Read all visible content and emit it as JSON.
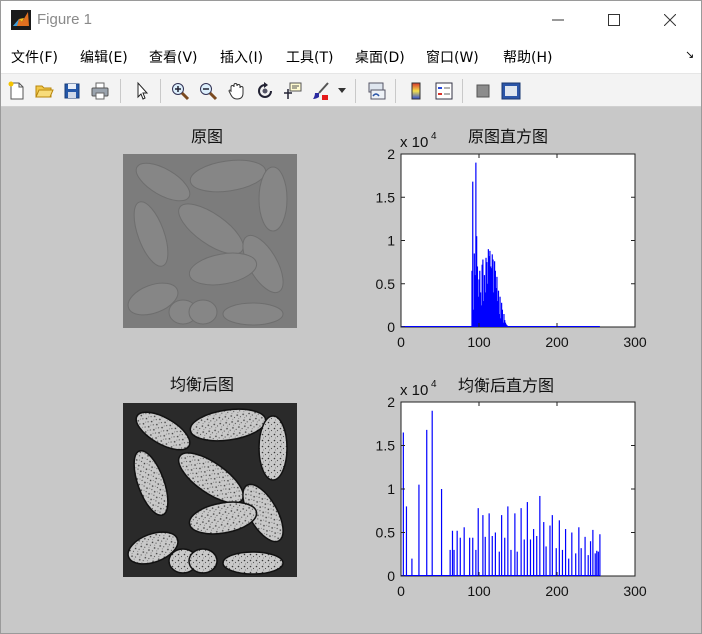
{
  "window": {
    "title": "Figure 1",
    "icon": "matlab-figure-icon",
    "controls": [
      "minimize-icon",
      "maximize-icon",
      "close-icon"
    ]
  },
  "menu": {
    "items": [
      "文件(F)",
      "编辑(E)",
      "查看(V)",
      "插入(I)",
      "工具(T)",
      "桌面(D)",
      "窗口(W)",
      "帮助(H)"
    ],
    "overflow_glyph": "↘"
  },
  "toolbar": {
    "icons": [
      "new-figure-icon",
      "open-file-icon",
      "save-icon",
      "print-icon",
      "edit-plot-arrow-icon",
      "zoom-in-icon",
      "zoom-out-icon",
      "pan-hand-icon",
      "rotate-3d-icon",
      "data-cursor-icon",
      "brush-icon",
      "brush-dropdown-icon",
      "link-plot-icon",
      "insert-colorbar-icon",
      "insert-legend-icon",
      "hide-plot-tools-icon",
      "show-plot-tools-icon"
    ]
  },
  "panels": {
    "original_image_title": "原图",
    "equalized_image_title": "均衡后图"
  },
  "chart_data": [
    {
      "type": "bar",
      "title": "原图直方图",
      "xlabel": "",
      "ylabel": "",
      "xlim": [
        0,
        300
      ],
      "ylim": [
        0,
        20000
      ],
      "xticks": [
        0,
        100,
        200,
        300
      ],
      "yticks": [
        0,
        0.5,
        1,
        1.5,
        2
      ],
      "ytick_labels": [
        "0",
        "0.5",
        "1",
        "1.5",
        "2"
      ],
      "y_exponent_label": "x 10",
      "y_exponent_power": "4",
      "color": "#0000ff",
      "grid": false,
      "x": [
        91,
        92,
        93,
        94,
        95,
        96,
        97,
        98,
        99,
        100,
        101,
        102,
        103,
        104,
        105,
        106,
        107,
        108,
        109,
        110,
        111,
        112,
        113,
        114,
        115,
        116,
        117,
        118,
        119,
        120,
        121,
        122,
        123,
        124,
        125,
        126,
        127,
        128,
        129,
        130,
        131,
        132,
        133,
        134,
        135,
        136,
        137,
        138
      ],
      "values": [
        6500,
        16800,
        2000,
        8500,
        6000,
        19000,
        10500,
        7000,
        3500,
        5500,
        6500,
        4000,
        2500,
        7200,
        7800,
        3000,
        6000,
        4000,
        8000,
        7500,
        5000,
        9000,
        8200,
        8800,
        7000,
        6800,
        8400,
        7800,
        4000,
        7600,
        6500,
        4500,
        5800,
        3000,
        4200,
        1500,
        3500,
        1000,
        2800,
        2000,
        500,
        1500,
        800,
        500,
        300,
        200,
        100,
        0
      ]
    },
    {
      "type": "bar",
      "title": "均衡后直方图",
      "xlabel": "",
      "ylabel": "",
      "xlim": [
        0,
        300
      ],
      "ylim": [
        0,
        20000
      ],
      "xticks": [
        0,
        100,
        200,
        300
      ],
      "yticks": [
        0,
        0.5,
        1,
        1.5,
        2
      ],
      "ytick_labels": [
        "0",
        "0.5",
        "1",
        "1.5",
        "2"
      ],
      "y_exponent_label": "x 10",
      "y_exponent_power": "4",
      "color": "#0000ff",
      "grid": false,
      "x": [
        3,
        7,
        14,
        23,
        33,
        40,
        52,
        63,
        66,
        68,
        72,
        76,
        81,
        88,
        92,
        96,
        99,
        105,
        108,
        113,
        117,
        121,
        126,
        129,
        133,
        137,
        141,
        146,
        149,
        154,
        158,
        162,
        166,
        170,
        174,
        178,
        183,
        186,
        191,
        194,
        199,
        203,
        207,
        211,
        215,
        219,
        224,
        228,
        231,
        236,
        240,
        243,
        246,
        249,
        251,
        253,
        255
      ],
      "values": [
        16500,
        8000,
        2000,
        10500,
        16800,
        19000,
        10000,
        3000,
        5200,
        3000,
        5200,
        4400,
        5600,
        4400,
        4400,
        3000,
        7800,
        7000,
        4500,
        7200,
        4600,
        5000,
        2800,
        7000,
        4400,
        8000,
        3000,
        7200,
        2800,
        7800,
        4200,
        8500,
        4200,
        5400,
        4600,
        9200,
        6200,
        3400,
        5800,
        7000,
        3200,
        6400,
        3000,
        5400,
        2000,
        5000,
        2600,
        5600,
        3200,
        4500,
        2400,
        4000,
        5300,
        2600,
        2900,
        2800,
        4800
      ]
    }
  ]
}
